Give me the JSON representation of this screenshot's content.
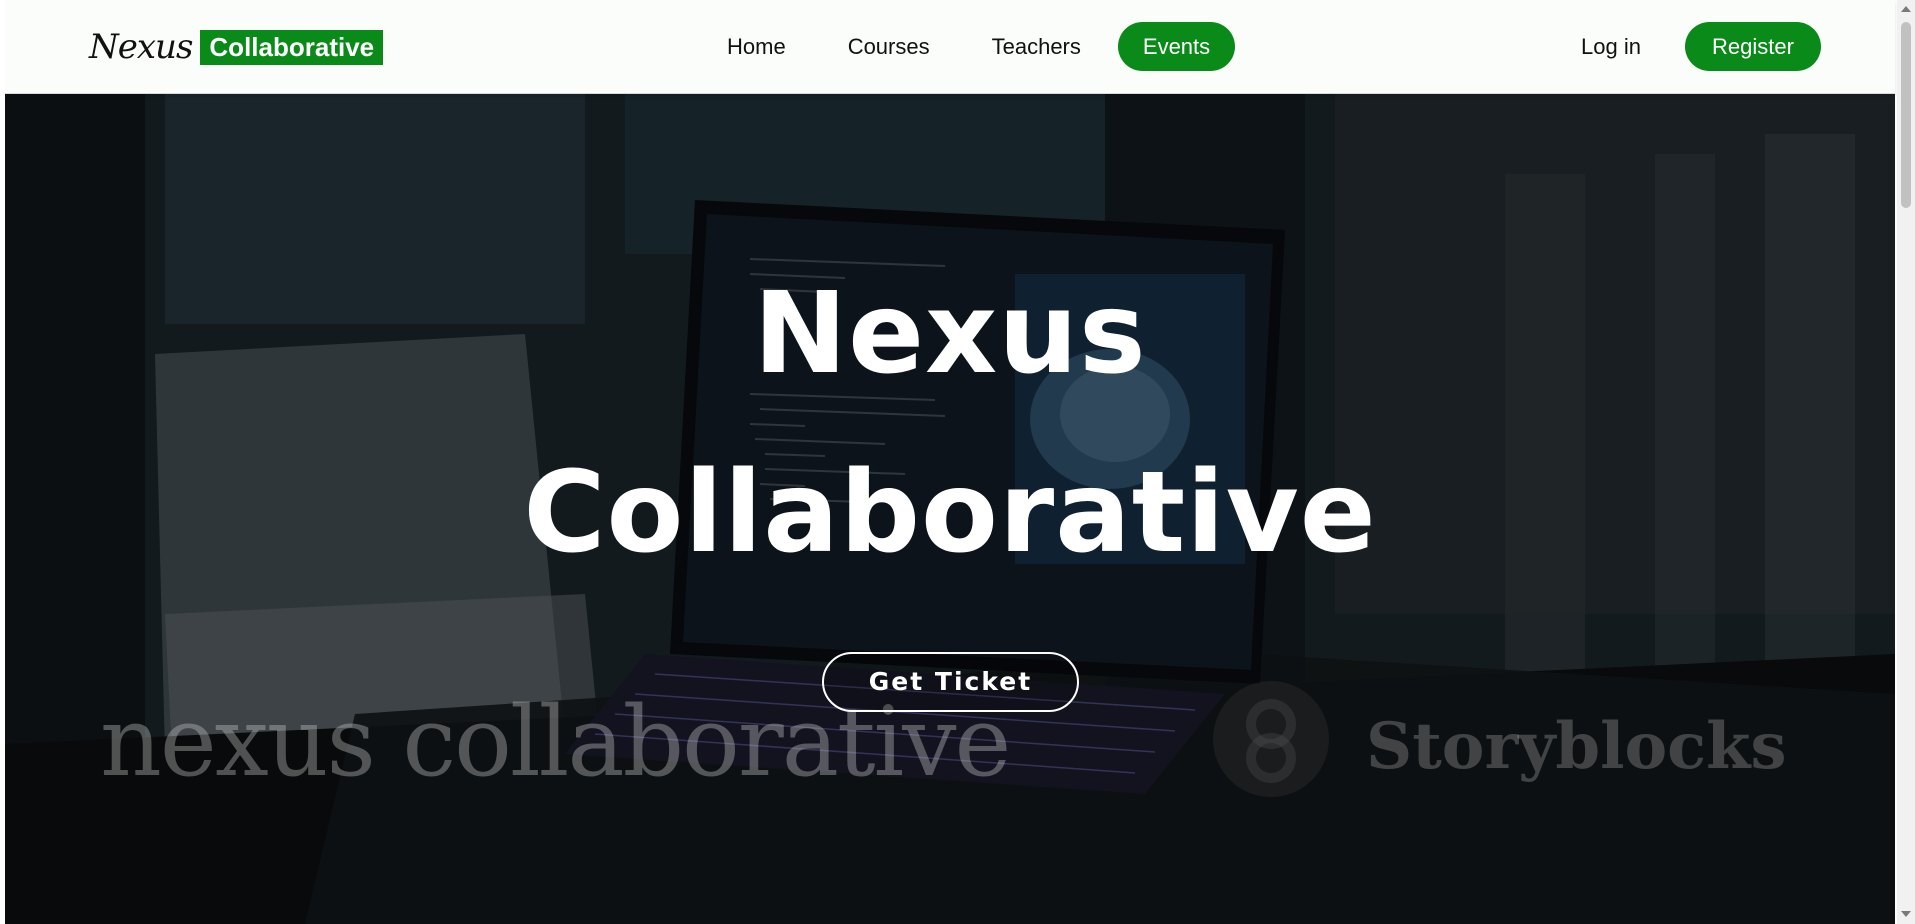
{
  "header": {
    "logo_script": "Nexus",
    "logo_box": "Collaborative",
    "nav": [
      {
        "label": "Home"
      },
      {
        "label": "Courses"
      },
      {
        "label": "Teachers"
      },
      {
        "label": "Events"
      }
    ],
    "active_nav": "Events",
    "login_label": "Log in",
    "register_label": "Register"
  },
  "hero": {
    "title_line1": "Nexus",
    "title_line2": "Collaborative",
    "cta_label": "Get Ticket",
    "watermark_text": "nexus collaborative",
    "watermark_brand": "Storyblocks"
  },
  "colors": {
    "accent": "#0a8a18",
    "nav_background": "#fbfdfb",
    "hero_text": "#ffffff"
  },
  "icons": {
    "scroll_up": "triangle-up-icon",
    "scroll_down": "triangle-down-icon",
    "watermark_logo": "storyblocks-logo-icon"
  }
}
